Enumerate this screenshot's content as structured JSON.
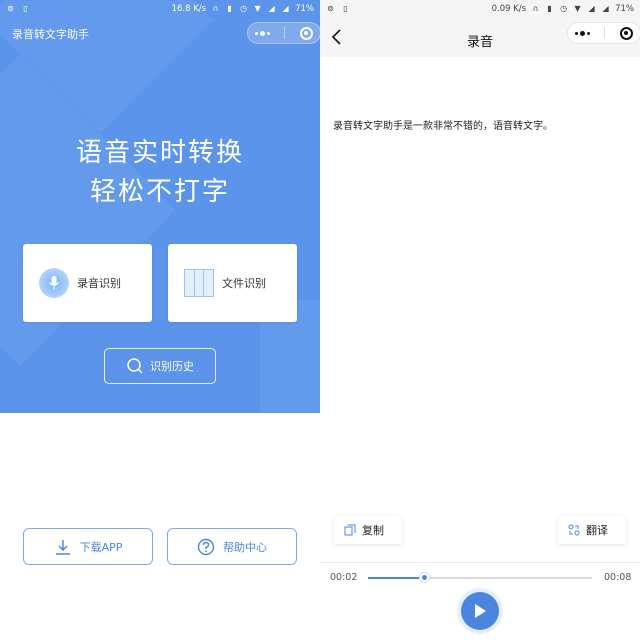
{
  "status_left": {
    "speed": "16.8 K/s",
    "battery": "71%"
  },
  "status_right": {
    "speed": "0.09 K/s",
    "battery": "71%"
  },
  "home": {
    "app_title": "录音转文字助手",
    "headline_1": "语音实时转换",
    "headline_2": "轻松不打字",
    "cards": [
      {
        "label": "录音识别",
        "icon": "microphone-icon"
      },
      {
        "label": "文件识别",
        "icon": "file-columns-icon"
      }
    ],
    "history_label": "识别历史",
    "bottom_buttons": [
      {
        "label": "下载APP",
        "icon": "download-icon"
      },
      {
        "label": "帮助中心",
        "icon": "help-icon"
      }
    ]
  },
  "recording": {
    "title": "录音",
    "transcript": "录音转文字助手是一款非常不错的，语音转文字。",
    "copy_label": "复制",
    "translate_label": "翻译",
    "current_time": "00:02",
    "total_time": "00:08",
    "progress": 0.25
  },
  "colors": {
    "primary": "#4a86e0",
    "hero_bg": "#5b94ea",
    "nav_bg": "#f5f5f5"
  }
}
